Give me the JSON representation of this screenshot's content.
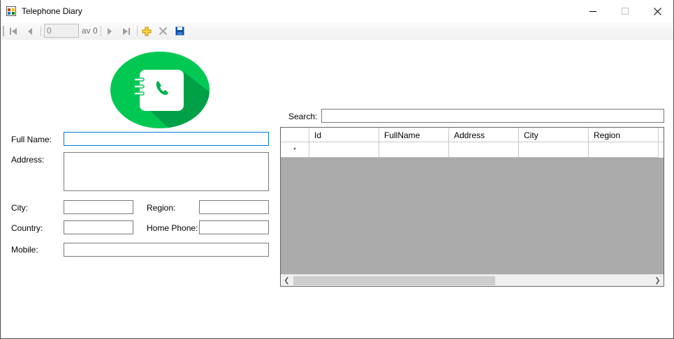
{
  "window": {
    "title": "Telephone Diary",
    "icon": "app-window-icon"
  },
  "toolbar": {
    "position_value": "0",
    "count_label": "av 0",
    "icons": [
      "move-first-icon",
      "move-previous-icon",
      "move-next-icon",
      "move-last-icon",
      "add-new-icon",
      "delete-icon",
      "save-icon"
    ]
  },
  "logo": {
    "icon": "phonebook-logo-icon",
    "colors": {
      "circle": "#00c853",
      "book": "#ffffff",
      "shadow": "#00a046"
    }
  },
  "form": {
    "full_name_label": "Full Name:",
    "address_label": "Address:",
    "city_label": "City:",
    "region_label": "Region:",
    "country_label": "Country:",
    "home_phone_label": "Home Phone:",
    "mobile_label": "Mobile:",
    "full_name_value": "",
    "address_value": "",
    "city_value": "",
    "region_value": "",
    "country_value": "",
    "home_phone_value": "",
    "mobile_value": ""
  },
  "search": {
    "label": "Search:",
    "value": ""
  },
  "grid": {
    "columns": [
      "Id",
      "FullName",
      "Address",
      "City",
      "Region"
    ],
    "new_row_marker": "*",
    "rows": []
  },
  "colors": {
    "accent": "#0078d7",
    "grid_background": "#ababab"
  }
}
